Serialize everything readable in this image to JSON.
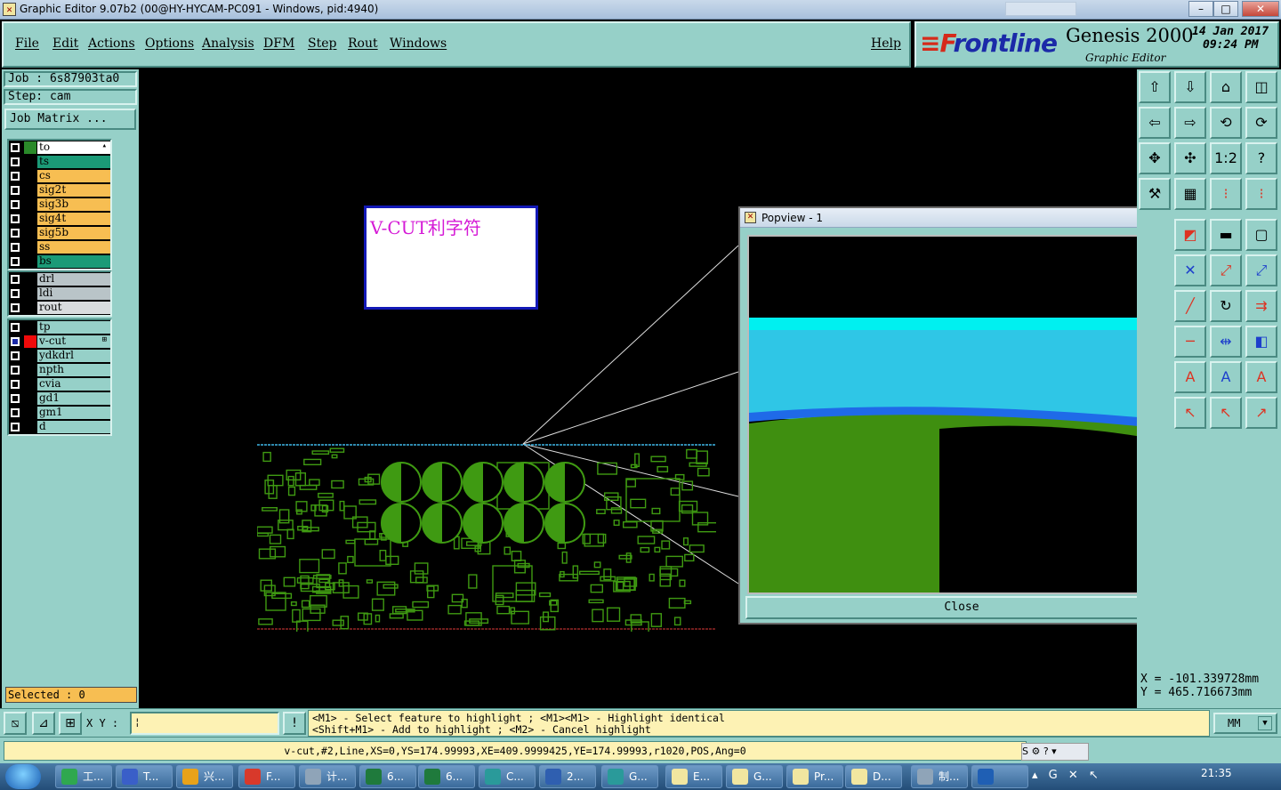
{
  "window": {
    "title": "Graphic Editor 9.07b2 (00@HY-HYCAM-PC091 - Windows, pid:4940)",
    "min": "–",
    "max": "□",
    "close": "✕"
  },
  "menu": [
    "File",
    "Edit",
    "Actions",
    "Options",
    "Analysis",
    "DFM",
    "Step",
    "Rout",
    "Windows"
  ],
  "help": "Help",
  "brand": {
    "logo_f": "≡F",
    "logo_rest": "rontline",
    "product": "Genesis 2000",
    "subtitle": "Graphic Editor",
    "date": "14 Jan 2017",
    "time": "09:24 PM"
  },
  "left_panel": {
    "job": "Job : 6s87903ta0",
    "step": "Step: cam",
    "job_matrix": "Job Matrix ...",
    "selected": "Selected : 0"
  },
  "layers": {
    "board": [
      {
        "name": "to",
        "swatch": "#2a8a2a",
        "bg": "#ffffff",
        "mark": "▴"
      },
      {
        "name": "ts",
        "swatch": "#000000",
        "bg": "#1b9a77"
      },
      {
        "name": "cs",
        "swatch": "#000000",
        "bg": "#f7be52"
      },
      {
        "name": "sig2t",
        "swatch": "#000000",
        "bg": "#f7be52"
      },
      {
        "name": "sig3b",
        "swatch": "#000000",
        "bg": "#f7be52"
      },
      {
        "name": "sig4t",
        "swatch": "#000000",
        "bg": "#f7be52"
      },
      {
        "name": "sig5b",
        "swatch": "#000000",
        "bg": "#f7be52"
      },
      {
        "name": "ss",
        "swatch": "#000000",
        "bg": "#f7be52"
      },
      {
        "name": "bs",
        "swatch": "#000000",
        "bg": "#1b9a77"
      }
    ],
    "drill": [
      {
        "name": "drl",
        "swatch": "#000000",
        "bg": "#b9c4c8"
      },
      {
        "name": "ldi",
        "swatch": "#000000",
        "bg": "#b9c4c8"
      },
      {
        "name": "rout",
        "swatch": "#000000",
        "bg": "#d9dcde"
      }
    ],
    "misc": [
      {
        "name": "tp",
        "swatch": "#000000",
        "bg": "#96d0c8"
      },
      {
        "name": "v-cut",
        "swatch": "#f00a0a",
        "bg": "#96d0c8",
        "mark": "⊞",
        "active": true
      },
      {
        "name": "ydkdrl",
        "swatch": "#000000",
        "bg": "#96d0c8"
      },
      {
        "name": "npth",
        "swatch": "#000000",
        "bg": "#96d0c8"
      },
      {
        "name": "cvia",
        "swatch": "#000000",
        "bg": "#96d0c8"
      },
      {
        "name": "gd1",
        "swatch": "#000000",
        "bg": "#96d0c8"
      },
      {
        "name": "gm1",
        "swatch": "#000000",
        "bg": "#96d0c8"
      },
      {
        "name": "d",
        "swatch": "#000000",
        "bg": "#96d0c8"
      }
    ]
  },
  "canvas": {
    "annotation": "V-CUT利字符"
  },
  "popview": {
    "title": "Popview - 1",
    "close_x": "✕",
    "close_button": "Close"
  },
  "coords": {
    "x": "X  = -101.339728mm",
    "y": "Y  =  465.716673mm"
  },
  "cmdbar": {
    "xy_label": "X Y :",
    "xy_value": "¦",
    "hint1": "<M1> - Select feature to highlight ; <M1><M1> - Highlight identical",
    "hint2": "<Shift+M1> - Add to highlight ; <M2> - Cancel highlight",
    "units": "MM",
    "units_arrow": "▼"
  },
  "status": {
    "info": "v-cut,#2,Line,XS=0,YS=174.99993,XE=409.9999425,YE=174.99993,r1020,POS,Ang=0",
    "ime": "S ⚙ ? ▾"
  },
  "taskbar": {
    "items": [
      {
        "label": "工...",
        "color": "#2fa84f"
      },
      {
        "label": "T...",
        "color": "#3a5fc8"
      },
      {
        "label": "兴...",
        "color": "#e8a21a"
      },
      {
        "label": "F...",
        "color": "#d8392b"
      },
      {
        "label": "计...",
        "color": "#8fa4b8"
      },
      {
        "label": "6...",
        "color": "#1f7a3c"
      },
      {
        "label": "6...",
        "color": "#1f7a3c"
      },
      {
        "label": "C...",
        "color": "#2a9a9a"
      },
      {
        "label": "2...",
        "color": "#2f5fb0"
      },
      {
        "label": "G...",
        "color": "#2a9a9a"
      },
      {
        "label": "E...",
        "color": "#f1e6a0"
      },
      {
        "label": "G...",
        "color": "#f1e6a0"
      },
      {
        "label": "Pr...",
        "color": "#f1e6a0"
      },
      {
        "label": "D...",
        "color": "#f1e6a0"
      },
      {
        "label": "制...",
        "color": "#8fa4b8"
      },
      {
        "label": "",
        "color": "#1f5fb4"
      }
    ],
    "tray": "▴ G ✕ ↖",
    "clock": "21:35"
  }
}
